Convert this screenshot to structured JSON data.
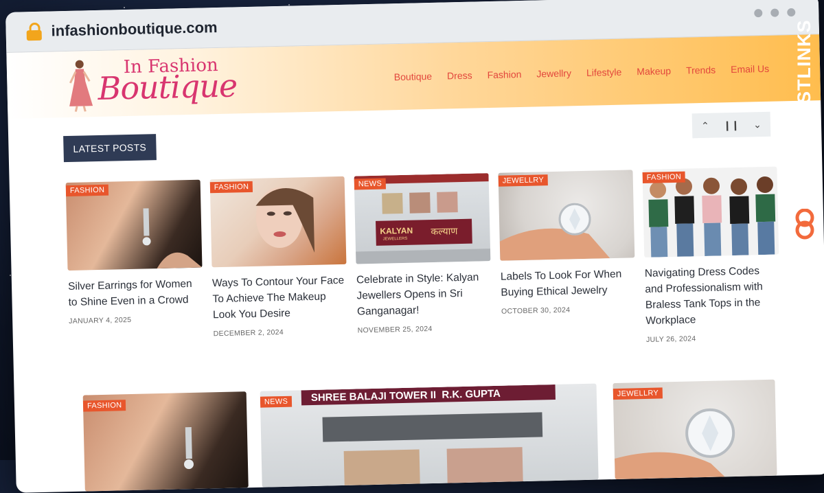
{
  "browser": {
    "url": "infashionboutique.com"
  },
  "site": {
    "logo_top": "In Fashion",
    "logo_main": "Boutique",
    "nav": [
      "Boutique",
      "Dress",
      "Fashion",
      "Jewellry",
      "Lifestyle",
      "Makeup",
      "Trends",
      "Email Us"
    ]
  },
  "ticker": {
    "label": "LATEST POSTS",
    "up": "⌃",
    "pause": "❙❙",
    "down": "⌄"
  },
  "posts": [
    {
      "category": "FASHION",
      "title": "Silver Earrings for Women to Shine Even in a Crowd",
      "date": "JANUARY 4, 2025"
    },
    {
      "category": "FASHION",
      "title": "Ways To Contour Your Face To Achieve The Makeup Look You Desire",
      "date": "DECEMBER 2, 2024"
    },
    {
      "category": "NEWS",
      "title": "Celebrate in Style: Kalyan Jewellers Opens in Sri Ganganagar!",
      "date": "NOVEMBER 25, 2024"
    },
    {
      "category": "JEWELLRY",
      "title": "Labels To Look For When Buying Ethical Jewelry",
      "date": "OCTOBER 30, 2024"
    },
    {
      "category": "FASHION",
      "title": "Navigating Dress Codes and Professionalism with Braless Tank Tops in the Workplace",
      "date": "JULY 26, 2024"
    }
  ],
  "kalyan_sign": {
    "brand": "KALYAN",
    "sub": "JEWELLERS",
    "hindi": "कल्याण"
  },
  "featured": [
    {
      "category": "FASHION"
    },
    {
      "category": "NEWS",
      "banner": "SHREE BALAJI TOWER II  R.K. GUPTA"
    },
    {
      "category": "JEWELLRY"
    }
  ],
  "side_brand": "GUESTPOSTLINKS",
  "colors": {
    "accent": "#e8562c",
    "nav": "#e2463c",
    "logo": "#d8356f",
    "ticker_label_bg": "#2f3b55"
  }
}
